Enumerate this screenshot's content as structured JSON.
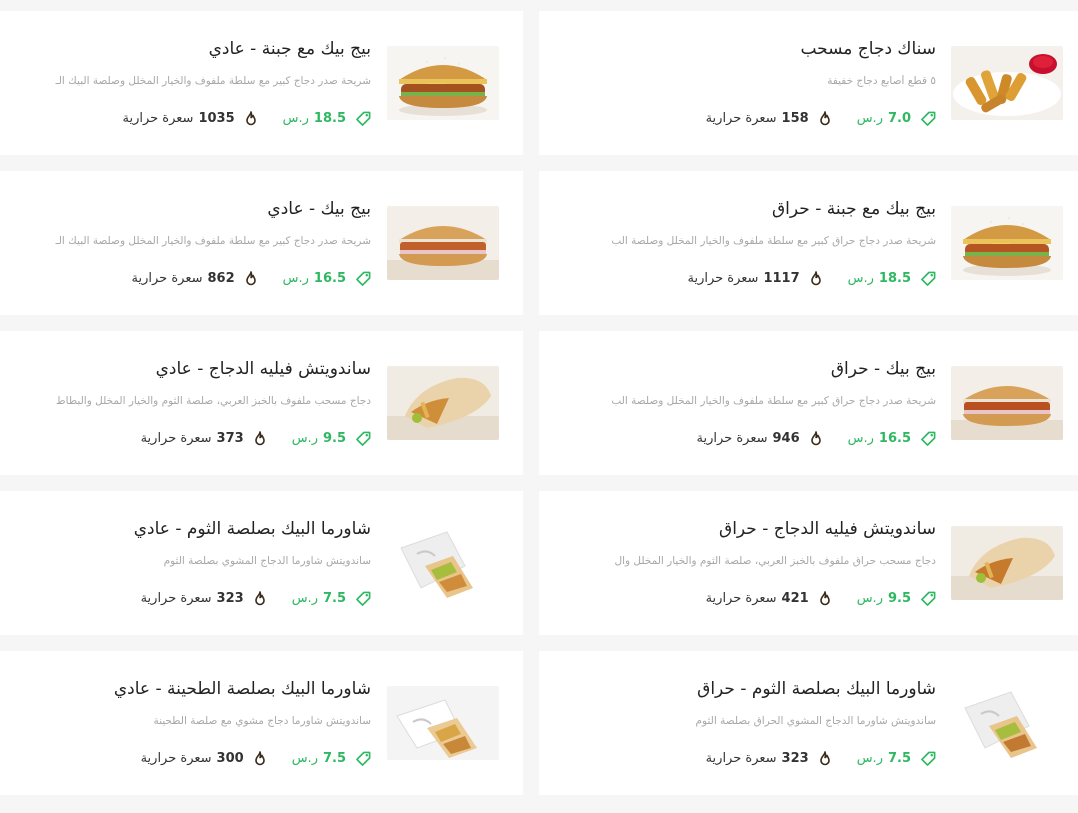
{
  "labels": {
    "currency": "ر.س",
    "calories": "سعرة حرارية"
  },
  "colors": {
    "accent": "#2eb862",
    "calorie_icon": "#3a2a1a"
  },
  "items": [
    {
      "title": "سناك دجاج مسحب",
      "desc": "٥ قطع أصابع دجاج خفيفة",
      "price": "7.0",
      "cal": "158",
      "image": "chicken-strips",
      "side": "right"
    },
    {
      "title": "بيج بيك مع جبنة - عادي",
      "desc": "شريحة صدر دجاج كبير مع سلطة ملفوف والخيار المخلل وصلصة البيك الـ",
      "price": "18.5",
      "cal": "1035",
      "image": "burger-cheese",
      "side": "left"
    },
    {
      "title": "بيج بيك مع جبنة - حراق",
      "desc": "شريحة صدر دجاج حراق كبير مع سلطة ملفوف والخيار المخلل وصلصة الب",
      "price": "18.5",
      "cal": "1117",
      "image": "burger-cheese",
      "side": "right"
    },
    {
      "title": "بيج بيك - عادي",
      "desc": "شريحة صدر دجاج كبير مع سلطة ملفوف والخيار المخلل وصلصة البيك الـ",
      "price": "16.5",
      "cal": "862",
      "image": "burger",
      "side": "left"
    },
    {
      "title": "بيج بيك - حراق",
      "desc": "شريحة صدر دجاج حراق كبير مع سلطة ملفوف والخيار المخلل وصلصة الب",
      "price": "16.5",
      "cal": "946",
      "image": "burger",
      "side": "right"
    },
    {
      "title": "ساندويتش فيليه الدجاج - عادي",
      "desc": "دجاج مسحب ملفوف بالخبز العربي، صلصة الثوم والخيار المخلل والبطاط",
      "price": "9.5",
      "cal": "373",
      "image": "wrap",
      "side": "left"
    },
    {
      "title": "ساندويتش فيليه الدجاج - حراق",
      "desc": "دجاج مسحب حراق ملفوف بالخبز العربي، صلصة الثوم والخيار المخلل وال",
      "price": "9.5",
      "cal": "421",
      "image": "wrap",
      "side": "right"
    },
    {
      "title": "شاورما البيك بصلصة الثوم - عادي",
      "desc": "ساندويتش شاورما الدجاج المشوي بصلصة الثوم",
      "price": "7.5",
      "cal": "323",
      "image": "shawarma",
      "side": "left"
    },
    {
      "title": "شاورما البيك بصلصة الثوم - حراق",
      "desc": "ساندويتش شاورما الدجاج المشوي الحراق بصلصة الثوم",
      "price": "7.5",
      "cal": "323",
      "image": "shawarma",
      "side": "right"
    },
    {
      "title": "شاورما البيك بصلصة الطحينة - عادي",
      "desc": "ساندويتش شاورما دجاج مشوي مع صلصة الطحينة",
      "price": "7.5",
      "cal": "300",
      "image": "shawarma",
      "side": "left"
    }
  ]
}
